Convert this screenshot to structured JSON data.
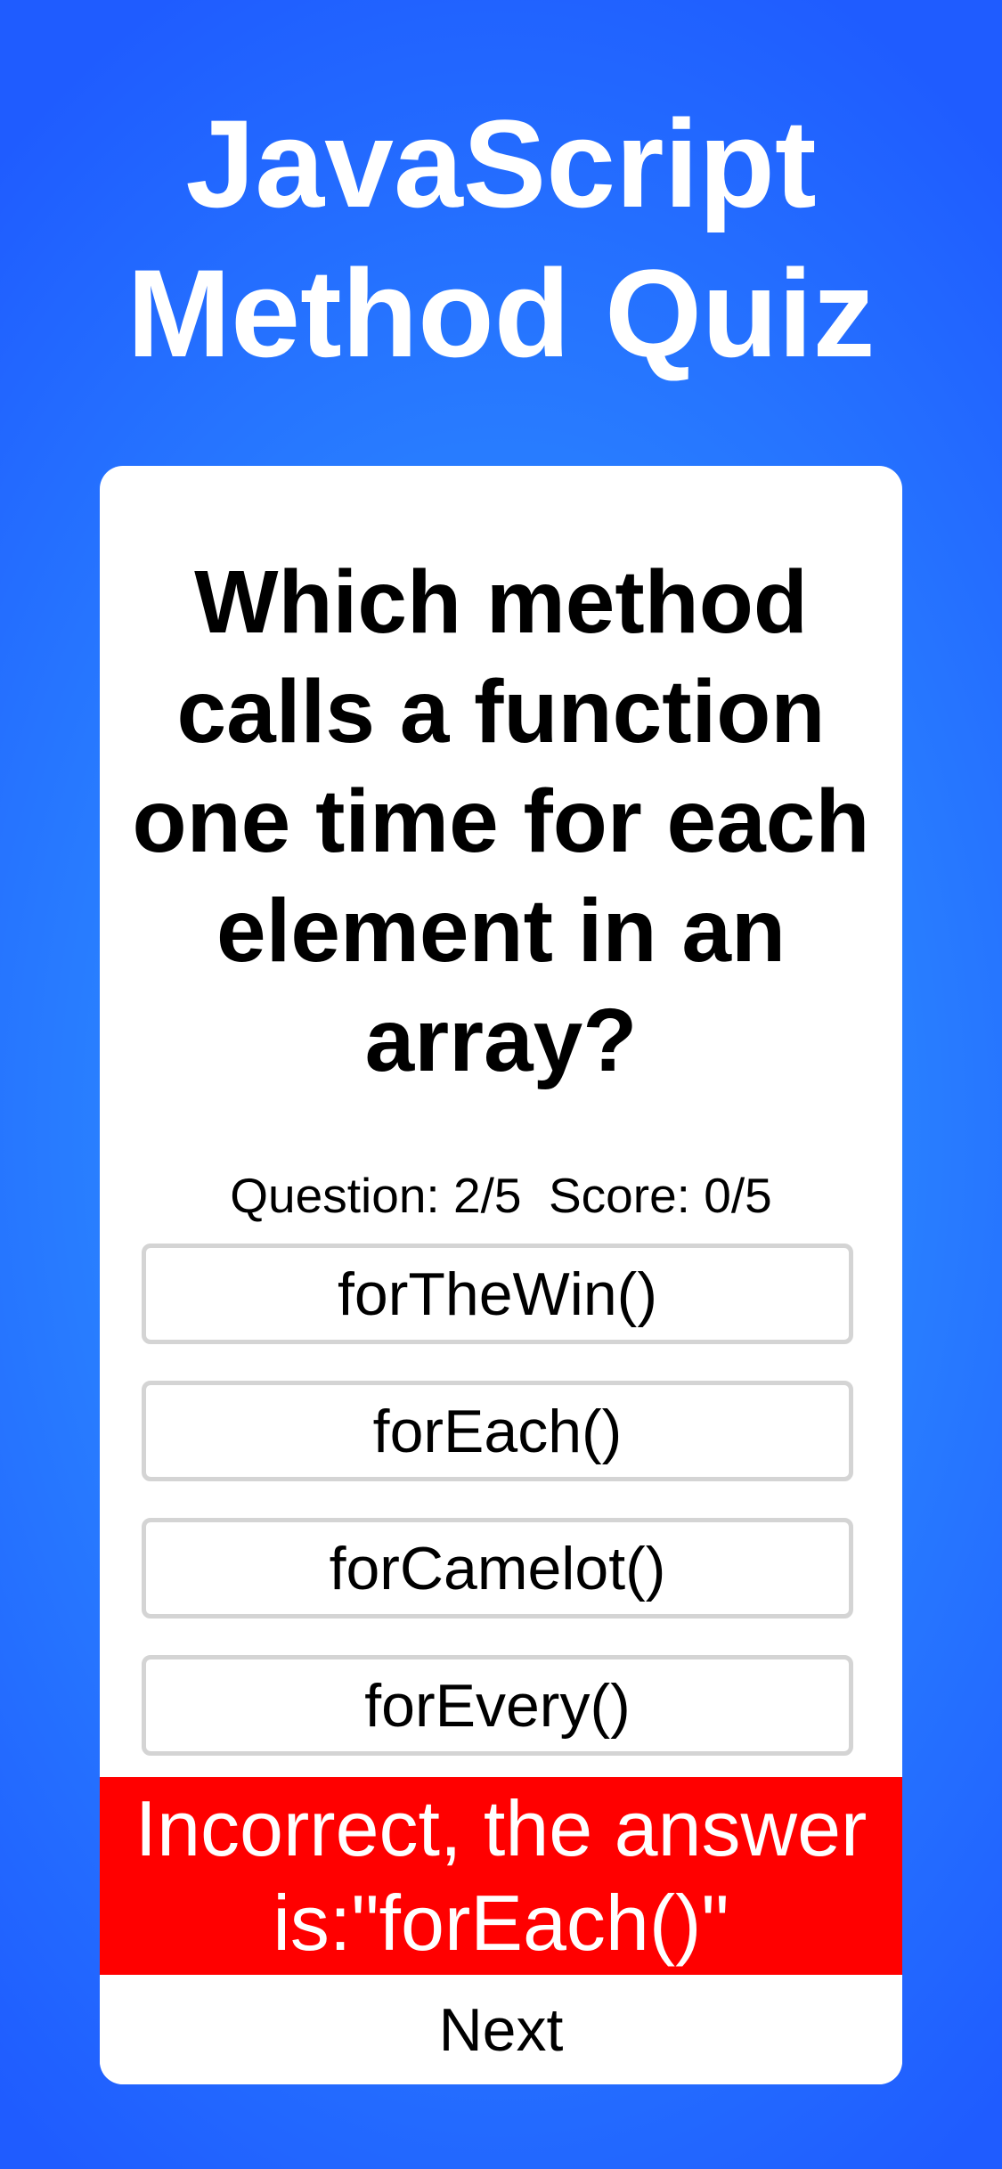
{
  "app": {
    "title_line1": "JavaScript",
    "title_line2": "Method Quiz"
  },
  "question": {
    "lines": [
      "Which method",
      "calls a function",
      "one time for each",
      "element in an",
      "array?"
    ],
    "status": "Question: 2/5  Score: 0/5"
  },
  "answers": [
    {
      "label": "forTheWin()"
    },
    {
      "label": "forEach()"
    },
    {
      "label": "forCamelot()"
    },
    {
      "label": "forEvery()"
    }
  ],
  "feedback": {
    "line1": "Incorrect, the answer",
    "line2": "is:\"forEach()\"",
    "background_color": "#ff0000",
    "text_color": "#ffffff"
  },
  "controls": {
    "next_label": "Next"
  },
  "colors": {
    "background_outer": "#1f5cff",
    "background_center": "#3aa3ff",
    "card": "#ffffff",
    "answer_border": "#d4d4d4"
  }
}
